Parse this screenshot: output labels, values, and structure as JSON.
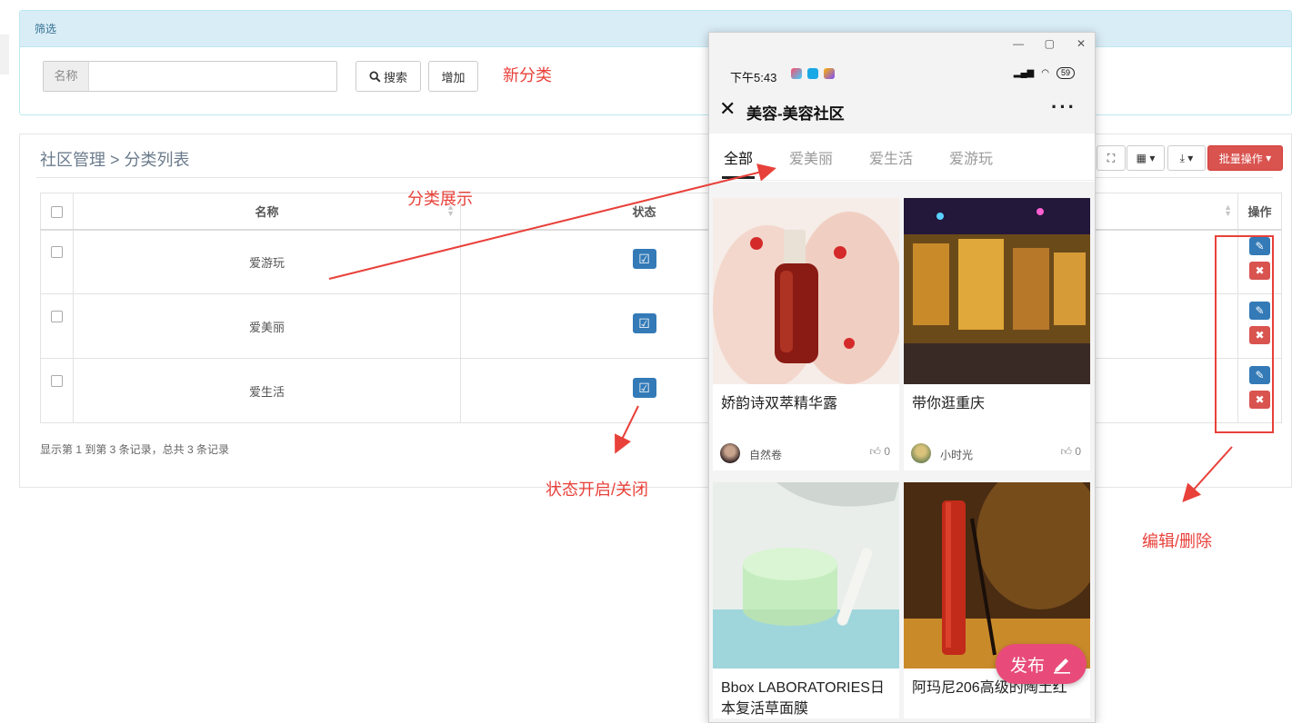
{
  "filter": {
    "title": "筛选",
    "name_label": "名称",
    "name_value": "",
    "search_label": "搜索",
    "add_label": "增加"
  },
  "list": {
    "breadcrumb": "社区管理 > 分类列表",
    "columns": {
      "name": "名称",
      "status": "状态",
      "ops": "操作"
    },
    "rows": [
      {
        "name": "爱游玩"
      },
      {
        "name": "爱美丽"
      },
      {
        "name": "爱生活"
      }
    ],
    "pager_info": "显示第 1 到第 3 条记录，总共 3 条记录",
    "batch_label": "批量操作"
  },
  "annotations": {
    "new_category": "新分类",
    "category_display": "分类展示",
    "status_toggle": "状态开启/关闭",
    "edit_delete": "编辑/删除",
    "highlight_color": "#e8413a"
  },
  "phone": {
    "time": "下午5:43",
    "battery": "59",
    "title": "美容-美容社区",
    "tabs": [
      "全部",
      "爱美丽",
      "爱生活",
      "爱游玩"
    ],
    "cards": [
      {
        "title": "娇韵诗双萃精华露",
        "author": "自然卷",
        "likes": "0"
      },
      {
        "title": "带你逛重庆",
        "author": "小时光",
        "likes": "0"
      },
      {
        "title": "Bbox LABORATORIES日本复活草面膜",
        "author": "",
        "likes": ""
      },
      {
        "title": "阿玛尼206高级的陶土红",
        "author": "",
        "likes": ""
      }
    ],
    "publish_label": "发布",
    "accent": "#e84b7a"
  }
}
